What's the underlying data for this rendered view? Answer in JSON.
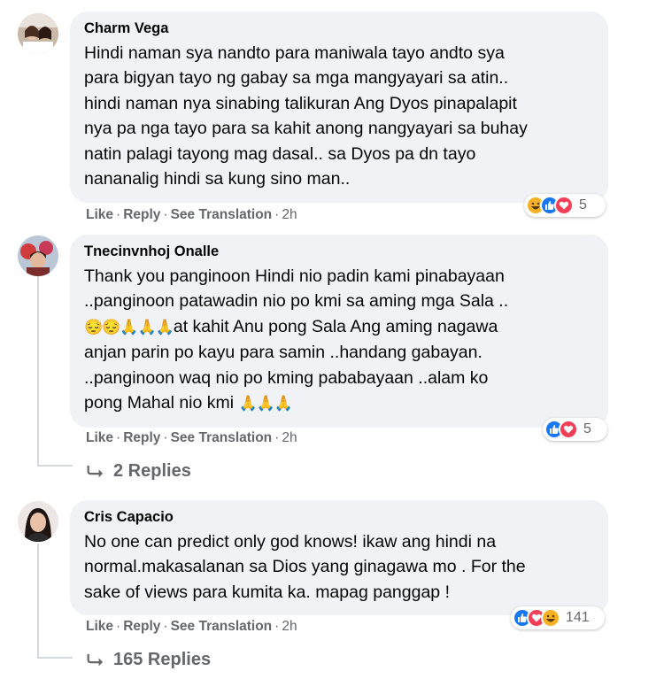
{
  "comments": [
    {
      "author": "Charm Vega",
      "lines": [
        "Hindi naman sya nandto para maniwala tayo andto sya",
        "para bigyan tayo ng gabay sa mga mangyayari sa atin..",
        "hindi naman nya sinabing talikuran Ang Dyos pinapalapit",
        "nya pa nga tayo para sa kahit anong nangyayari sa buhay",
        "natin palagi tayong mag dasal.. sa Dyos pa dn tayo",
        "nananalig hindi sa kung sino man.."
      ],
      "actions": {
        "like": "Like",
        "reply": "Reply",
        "translate": "See Translation",
        "time": "2h"
      },
      "reactions": {
        "icons": [
          "haha",
          "like",
          "love"
        ],
        "count": "5"
      }
    },
    {
      "author": "Tnecinvnhoj Onalle",
      "lines": [
        "Thank you panginoon Hindi nio padin kami pinabayaan",
        "..panginoon patawadin nio po kmi sa aming mga Sala ..",
        "at kahit Anu pong Sala Ang aming nagawa",
        "anjan parin po kayu para samin ..handang gabayan.",
        "..panginoon waq nio po kming pababayaan ..alam ko",
        "pong Mahal nio kmi"
      ],
      "emoji_line3": "😔😔🙏🙏🙏",
      "emoji_line6": "🙏🙏🙏",
      "actions": {
        "like": "Like",
        "reply": "Reply",
        "translate": "See Translation",
        "time": "2h"
      },
      "reactions": {
        "icons": [
          "like",
          "love"
        ],
        "count": "5"
      },
      "replies": "2 Replies"
    },
    {
      "author": "Cris Capacio",
      "lines": [
        "No one can predict only god knows! ikaw ang hindi na",
        "normal.makasalanan sa Dios yang ginagawa mo . For the",
        "sake of views para kumita ka. mapag panggap !"
      ],
      "actions": {
        "like": "Like",
        "reply": "Reply",
        "translate": "See Translation",
        "time": "2h"
      },
      "reactions": {
        "icons": [
          "like",
          "love",
          "haha"
        ],
        "count": "141"
      },
      "replies": "165 Replies"
    }
  ],
  "colors": {
    "like": "#1877f2",
    "love": "#f33e58",
    "haha": "#f7b125",
    "secondary": "#65676b",
    "bubble": "#f0f2f5"
  }
}
